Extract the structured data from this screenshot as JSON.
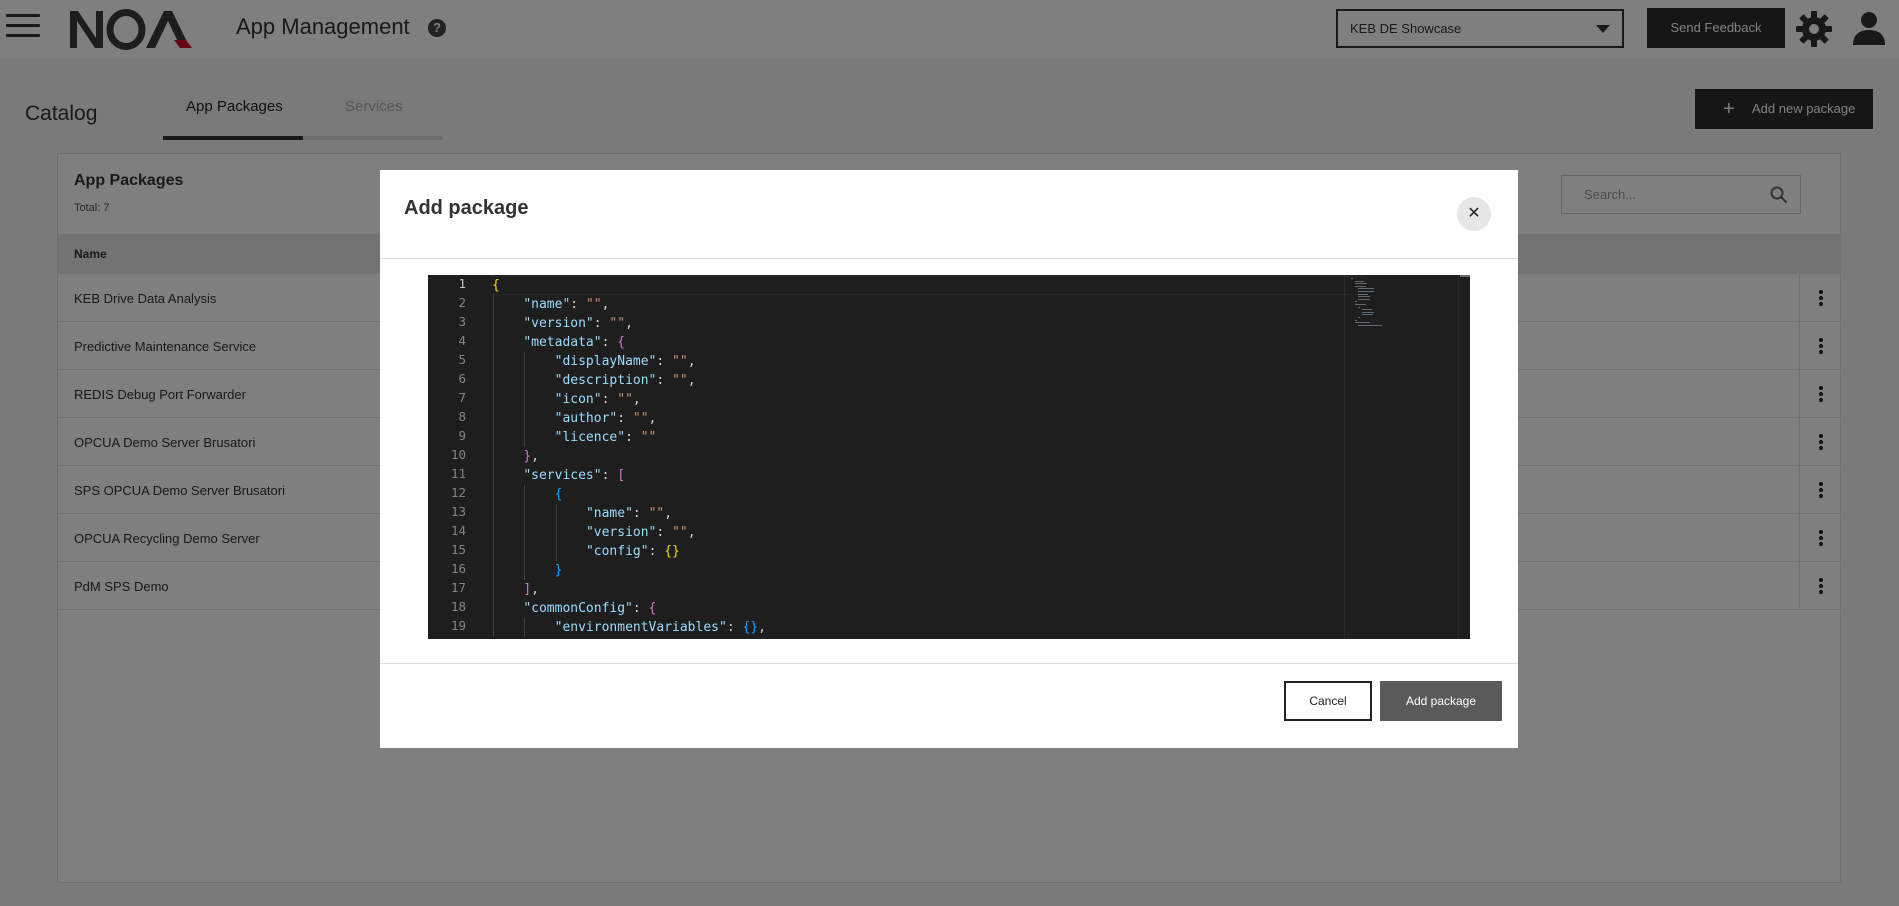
{
  "header": {
    "title": "App Management",
    "help_glyph": "?",
    "tenant_selected": "KEB DE Showcase",
    "feedback_label": "Send Feedback"
  },
  "catalog": {
    "title": "Catalog",
    "tabs": [
      {
        "label": "App Packages",
        "active": true
      },
      {
        "label": "Services",
        "active": false
      }
    ],
    "add_label": "Add new package"
  },
  "panel": {
    "title": "App Packages",
    "total": "Total: 7",
    "search_placeholder": "Search...",
    "column_name": "Name",
    "rows": [
      "KEB Drive Data Analysis",
      "Predictive Maintenance Service",
      "REDIS Debug Port Forwarder",
      "OPCUA Demo Server Brusatori",
      "SPS OPCUA Demo Server Brusatori",
      "OPCUA Recycling Demo Server",
      "PdM SPS Demo"
    ]
  },
  "modal": {
    "title": "Add package",
    "close_glyph": "✕",
    "cancel_label": "Cancel",
    "submit_label": "Add package",
    "editor": {
      "line_numbers": [
        "1",
        "2",
        "3",
        "4",
        "5",
        "6",
        "7",
        "8",
        "9",
        "10",
        "11",
        "12",
        "13",
        "14",
        "15",
        "16",
        "17",
        "18",
        "19"
      ],
      "lines": [
        "{",
        "    \"name\": \"\",",
        "    \"version\": \"\",",
        "    \"metadata\": {",
        "        \"displayName\": \"\",",
        "        \"description\": \"\",",
        "        \"icon\": \"\",",
        "        \"author\": \"\",",
        "        \"licence\": \"\"",
        "    },",
        "    \"services\": [",
        "        {",
        "            \"name\": \"\",",
        "            \"version\": \"\",",
        "            \"config\": {}",
        "        }",
        "    ],",
        "    \"commonConfig\": {",
        "        \"environmentVariables\": {},"
      ]
    }
  },
  "colors": {
    "overlay": "rgba(0,0,0,0.5)",
    "dark_button": "#2d2d2d",
    "editor_bg": "#1e1e1e",
    "logo_accent": "#c8102e"
  },
  "icons": [
    "hamburger-icon",
    "help-icon",
    "chevron-down-icon",
    "gear-icon",
    "user-icon",
    "plus-icon",
    "search-icon",
    "kebab-icon",
    "close-icon"
  ]
}
